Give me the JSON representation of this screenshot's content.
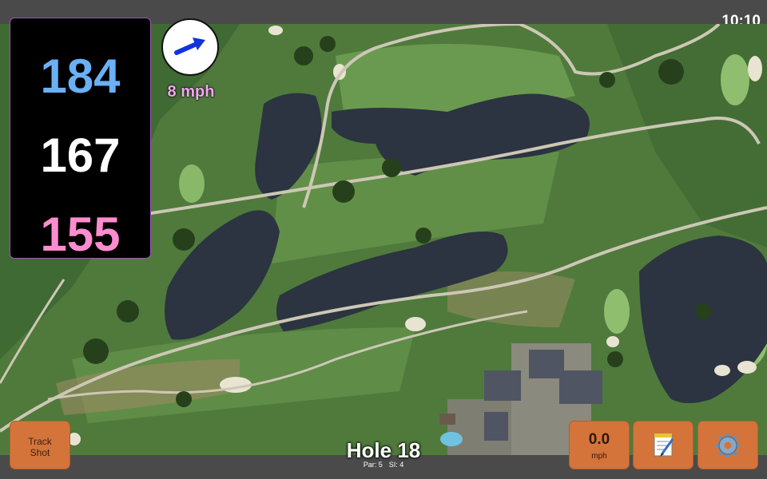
{
  "status_bar": {
    "time": "10:10"
  },
  "yardages": {
    "back": "184",
    "middle": "167",
    "front": "155"
  },
  "wind": {
    "speed": "8 mph",
    "icon": "wind-arrow-icon"
  },
  "hole": {
    "title": "Hole 18",
    "par": "Par: 5",
    "stroke_index": "SI: 4"
  },
  "buttons": {
    "track_shot_line1": "Track",
    "track_shot_line2": "Shot",
    "speed_value": "0.0",
    "speed_unit": "mph",
    "notes_icon": "notepad-icon",
    "settings_icon": "gear-icon"
  },
  "colors": {
    "back": "#6ab0f5",
    "middle": "#ffffff",
    "front": "#ff8ccf",
    "button": "#d4743a",
    "wind_text": "#f2a8f0"
  }
}
